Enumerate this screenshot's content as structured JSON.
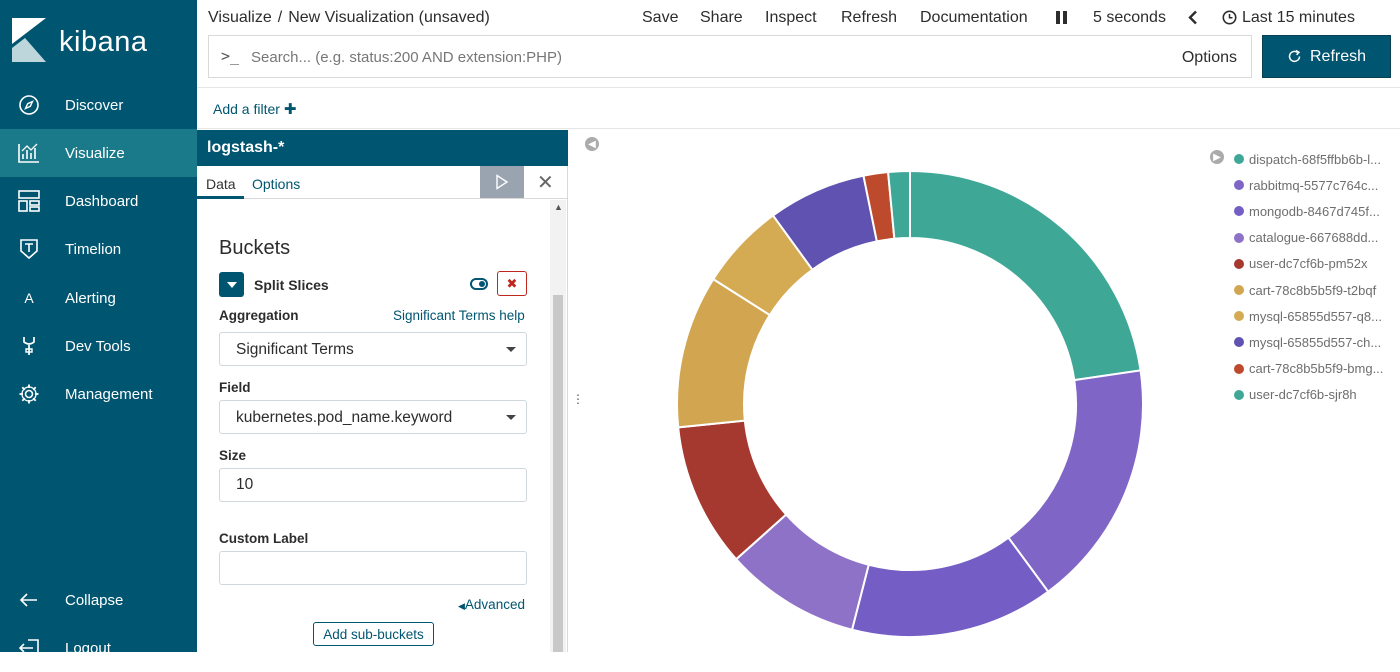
{
  "app": {
    "logo_text": "kibana"
  },
  "sidebar": {
    "items": [
      {
        "label": "Discover",
        "icon": "compass-icon"
      },
      {
        "label": "Visualize",
        "icon": "chart-icon",
        "active": true
      },
      {
        "label": "Dashboard",
        "icon": "dashboard-icon"
      },
      {
        "label": "Timelion",
        "icon": "shield-icon"
      },
      {
        "label": "Alerting",
        "icon": "letter-a-icon"
      },
      {
        "label": "Dev Tools",
        "icon": "wrench-icon"
      },
      {
        "label": "Management",
        "icon": "gear-icon"
      }
    ],
    "collapse_label": "Collapse",
    "logout_label": "Logout"
  },
  "header": {
    "breadcrumb_root": "Visualize",
    "breadcrumb_sep": "/",
    "breadcrumb_current": "New Visualization (unsaved)",
    "save": "Save",
    "share": "Share",
    "inspect": "Inspect",
    "refresh": "Refresh",
    "documentation": "Documentation",
    "interval": "5 seconds",
    "time_range": "Last 15 minutes"
  },
  "search": {
    "prompt": ">_",
    "placeholder": "Search... (e.g. status:200 AND extension:PHP)",
    "options_label": "Options",
    "refresh_label": "Refresh"
  },
  "filter": {
    "add_label": "Add a filter"
  },
  "editor": {
    "index_pattern": "logstash-*",
    "tabs": [
      "Data",
      "Options"
    ],
    "buckets_title": "Buckets",
    "split_label": "Split Slices",
    "aggregation_label": "Aggregation",
    "aggregation_help": "Significant Terms help",
    "aggregation_value": "Significant Terms",
    "field_label": "Field",
    "field_value": "kubernetes.pod_name.keyword",
    "size_label": "Size",
    "size_value": "10",
    "custom_label_label": "Custom Label",
    "custom_label_value": "",
    "advanced_label": "Advanced",
    "add_sub_buckets": "Add sub-buckets"
  },
  "colors": {
    "accent": "#005571",
    "sidebar_active": "#1a7a8a"
  },
  "chart_data": {
    "type": "pie",
    "donut": true,
    "slices": [
      {
        "name": "dispatch-68f5ffbb6b-l...",
        "value": 22.7,
        "color": "#3fa796"
      },
      {
        "name": "rabbitmq-5577c764c...",
        "value": 17.2,
        "color": "#7e65c6"
      },
      {
        "name": "mongodb-8467d745f...",
        "value": 14.1,
        "color": "#745dc5"
      },
      {
        "name": "catalogue-667688dd...",
        "value": 9.4,
        "color": "#8e72c8"
      },
      {
        "name": "user-dc7cf6b-pm52x",
        "value": 10.0,
        "color": "#a5392f"
      },
      {
        "name": "cart-78c8b5b5f9-t2bqf",
        "value": 10.6,
        "color": "#d2a651"
      },
      {
        "name": "mysql-65855d557-q8...",
        "value": 6.0,
        "color": "#d4aa53"
      },
      {
        "name": "mysql-65855d557-ch...",
        "value": 6.8,
        "color": "#5f52b1"
      },
      {
        "name": "cart-78c8b5b5f9-bmg...",
        "value": 1.7,
        "color": "#bd4a2c"
      },
      {
        "name": "user-dc7cf6b-sjr8h",
        "value": 1.5,
        "color": "#3fa796"
      }
    ]
  }
}
